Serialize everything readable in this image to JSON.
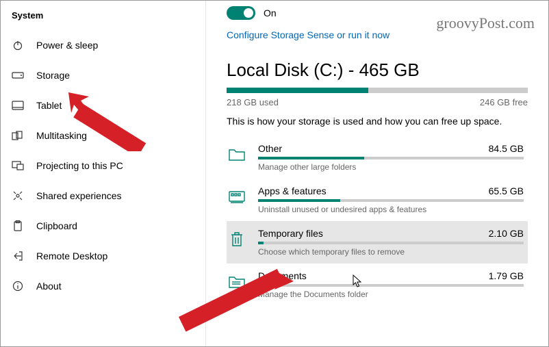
{
  "watermark": "groovyPost.com",
  "sidebar": {
    "title": "System",
    "items": [
      {
        "label": "Power & sleep"
      },
      {
        "label": "Storage"
      },
      {
        "label": "Tablet"
      },
      {
        "label": "Multitasking"
      },
      {
        "label": "Projecting to this PC"
      },
      {
        "label": "Shared experiences"
      },
      {
        "label": "Clipboard"
      },
      {
        "label": "Remote Desktop"
      },
      {
        "label": "About"
      }
    ]
  },
  "storage": {
    "toggle_label": "On",
    "configure_link": "Configure Storage Sense or run it now",
    "disk_title": "Local Disk (C:) - 465 GB",
    "used_label": "218 GB used",
    "free_label": "246 GB free",
    "description": "This is how your storage is used and how you can free up space.",
    "categories": [
      {
        "name": "Other",
        "size": "84.5 GB",
        "sub": "Manage other large folders"
      },
      {
        "name": "Apps & features",
        "size": "65.5 GB",
        "sub": "Uninstall unused or undesired apps & features"
      },
      {
        "name": "Temporary files",
        "size": "2.10 GB",
        "sub": "Choose which temporary files to remove"
      },
      {
        "name": "Documents",
        "size": "1.79 GB",
        "sub": "Manage the Documents folder"
      }
    ]
  }
}
